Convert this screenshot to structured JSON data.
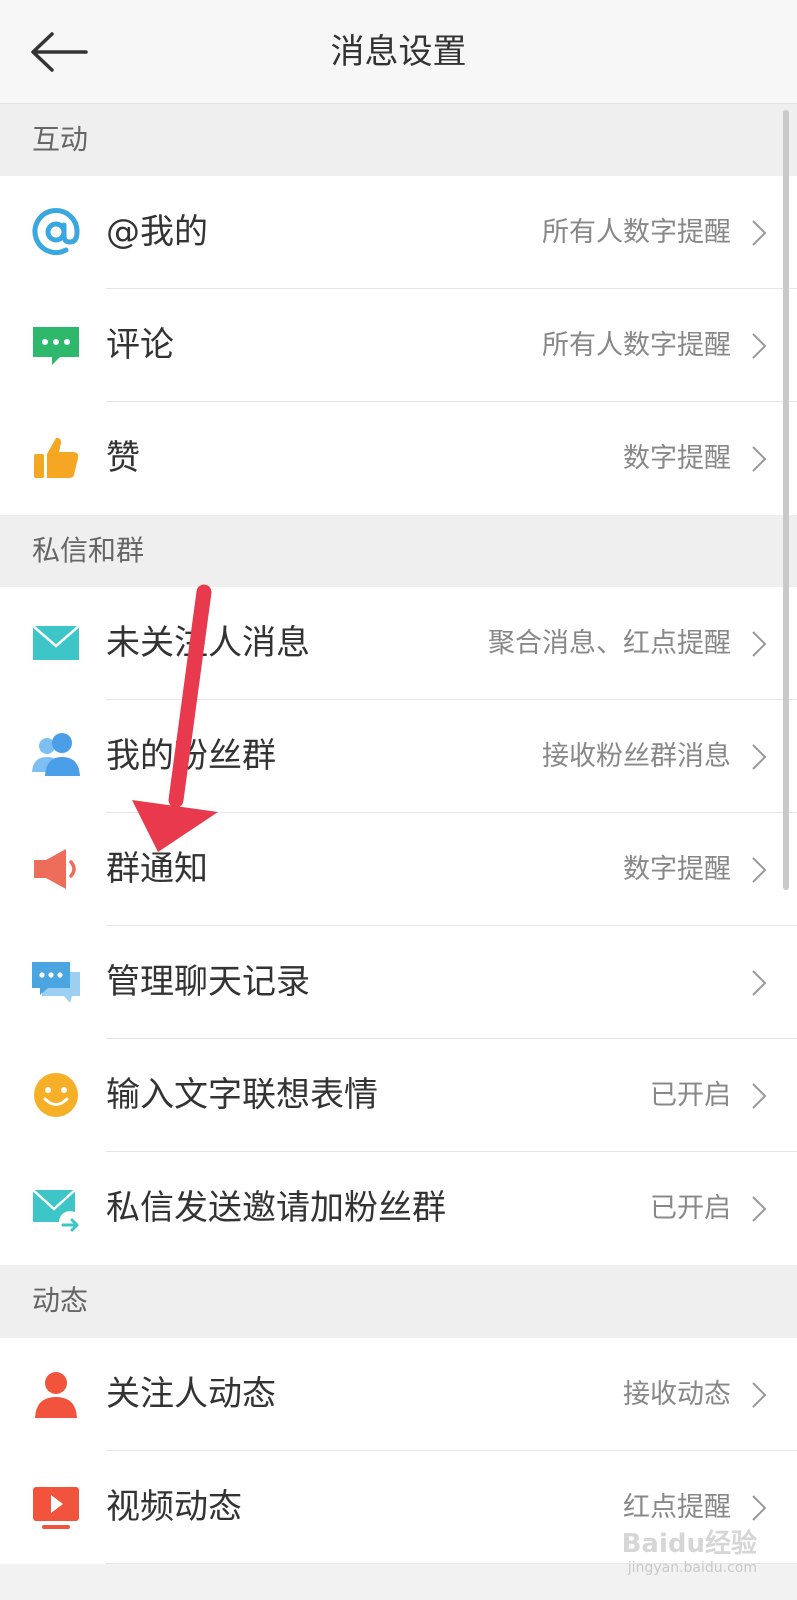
{
  "header": {
    "title": "消息设置"
  },
  "sections": [
    {
      "title": "互动"
    },
    {
      "title": "私信和群"
    },
    {
      "title": "动态"
    }
  ],
  "rows": [
    {
      "label": "@我的",
      "value": "所有人数字提醒",
      "icon": "at-icon",
      "color": "#3aa8e0"
    },
    {
      "label": "评论",
      "value": "所有人数字提醒",
      "icon": "comment-icon",
      "color": "#2db86b"
    },
    {
      "label": "赞",
      "value": "数字提醒",
      "icon": "thumbs-up-icon",
      "color": "#f5a623"
    },
    {
      "label": "未关注人消息",
      "value": "聚合消息、红点提醒",
      "icon": "mail-icon",
      "color": "#3ec5c8"
    },
    {
      "label": "我的粉丝群",
      "value": "接收粉丝群消息",
      "icon": "users-icon",
      "color": "#4a9ee8"
    },
    {
      "label": "群通知",
      "value": "数字提醒",
      "icon": "megaphone-icon",
      "color": "#ee6c5a"
    },
    {
      "label": "管理聊天记录",
      "value": "",
      "icon": "chat-bubbles-icon",
      "color": "#4aa5e0"
    },
    {
      "label": "输入文字联想表情",
      "value": "已开启",
      "icon": "smiley-icon",
      "color": "#f5b027"
    },
    {
      "label": "私信发送邀请加粉丝群",
      "value": "已开启",
      "icon": "mail-share-icon",
      "color": "#3ec5c8"
    },
    {
      "label": "关注人动态",
      "value": "接收动态",
      "icon": "person-icon",
      "color": "#f2533c"
    },
    {
      "label": "视频动态",
      "value": "红点提醒",
      "icon": "video-icon",
      "color": "#f2533c"
    }
  ],
  "overlay": {
    "arrow_color": "#e8394d"
  },
  "watermark": {
    "text": "Baidu经验",
    "sub": "jingyan.baidu.com"
  }
}
